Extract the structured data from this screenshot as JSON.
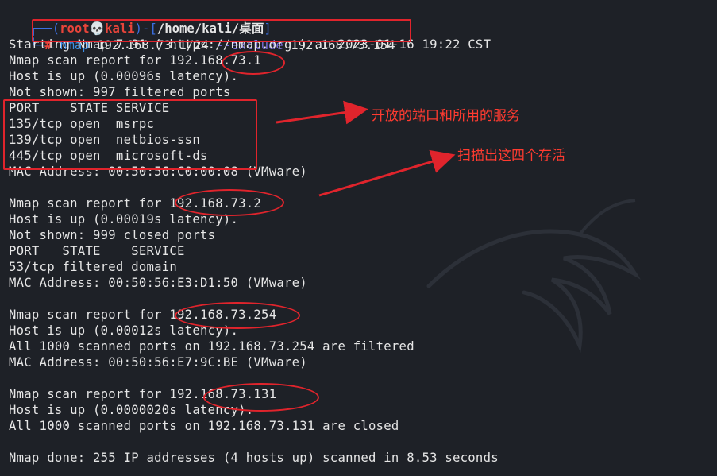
{
  "prompt": {
    "user": "root",
    "skull": "💀",
    "host": "kali",
    "path": "/home/kali/桌面",
    "hash": "#"
  },
  "command": {
    "program": "nmap",
    "target": "192.168.73.1/24",
    "option": "--exclude",
    "excluded": "192.168.73.154"
  },
  "output_lines": [
    "Starting Nmap 7.91 ( https://nmap.org ) at 2023-01-16 19:22 CST",
    "Nmap scan report for 192.168.73.1",
    "Host is up (0.00096s latency).",
    "Not shown: 997 filtered ports",
    "PORT    STATE SERVICE",
    "135/tcp open  msrpc",
    "139/tcp open  netbios-ssn",
    "445/tcp open  microsoft-ds",
    "MAC Address: 00:50:56:C0:00:08 (VMware)",
    "",
    "Nmap scan report for 192.168.73.2",
    "Host is up (0.00019s latency).",
    "Not shown: 999 closed ports",
    "PORT   STATE    SERVICE",
    "53/tcp filtered domain",
    "MAC Address: 00:50:56:E3:D1:50 (VMware)",
    "",
    "Nmap scan report for 192.168.73.254",
    "Host is up (0.00012s latency).",
    "All 1000 scanned ports on 192.168.73.254 are filtered",
    "MAC Address: 00:50:56:E7:9C:BE (VMware)",
    "",
    "Nmap scan report for 192.168.73.131",
    "Host is up (0.0000020s latency).",
    "All 1000 scanned ports on 192.168.73.131 are closed",
    "",
    "Nmap done: 255 IP addresses (4 hosts up) scanned in 8.53 seconds"
  ],
  "annotations": {
    "ports_note": "开放的端口和所用的服务",
    "hosts_note": "扫描出这四个存活"
  },
  "colors": {
    "background": "#1e2127",
    "prompt_frame": "#3b6fe0",
    "prompt_user": "#e8443a",
    "command": "#3b8ee6",
    "option": "#7a6fd8",
    "annotation": "#e0242c"
  }
}
